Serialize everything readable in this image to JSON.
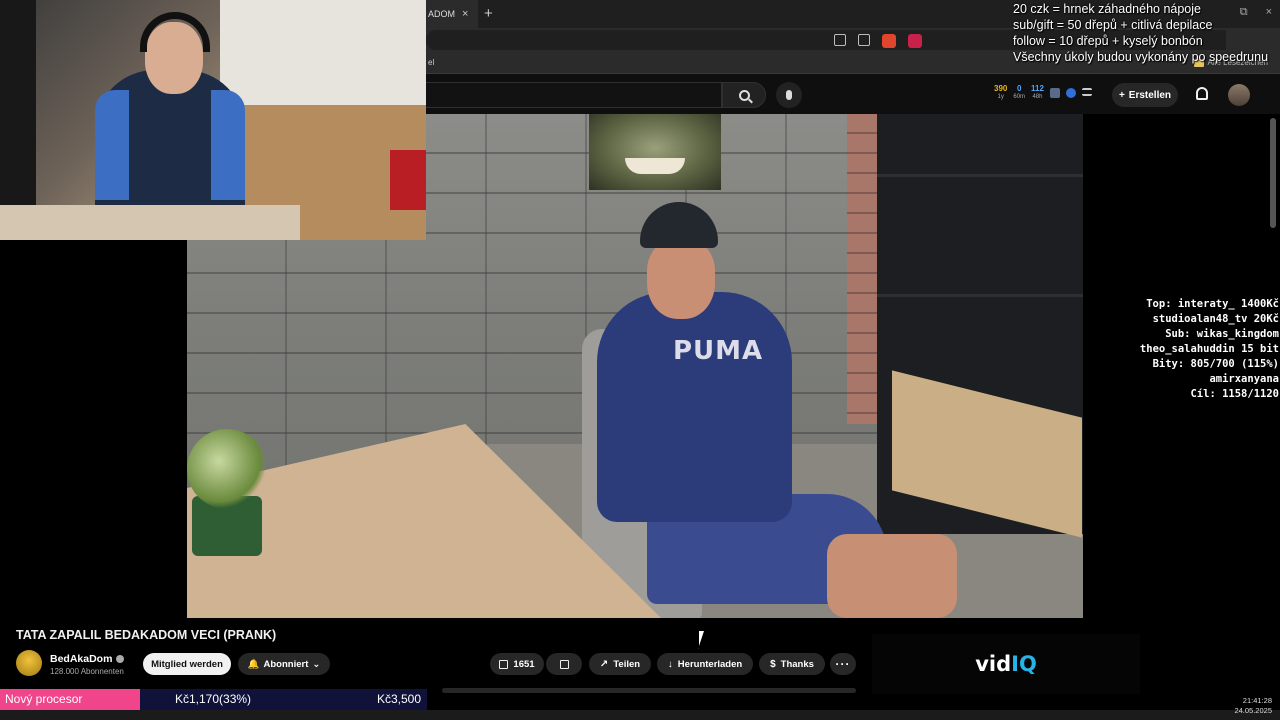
{
  "browser": {
    "tab_label": "ADOM",
    "tab_close": "×",
    "new_tab": "+",
    "bookmarks_short": "el",
    "all_bookmarks": "Alle Lesezeichen",
    "window_controls": [
      "⧉",
      "×"
    ]
  },
  "header": {
    "create_label": "Erstellen",
    "stats": [
      {
        "value": "390",
        "label": "1y",
        "color": "#e8b21e"
      },
      {
        "value": "0",
        "label": "60m",
        "color": "#4fa3ff"
      },
      {
        "value": "112",
        "label": "48h",
        "color": "#4fa3ff"
      }
    ]
  },
  "overlay_top": [
    "20 czk = hrnek záhadného nápoje",
    "sub/gift = 50 dřepů + citlivá depilace",
    "follow = 10 dřepů + kyselý bonbón",
    "Všechny úkoly budou vykonány po speedrunu"
  ],
  "overlay_right": [
    "Top: interaty_ 1400Kč",
    "studioalan48_tv 20Kč",
    "Sub: wikas_kingdom",
    "theo_salahuddin 15 bit",
    "Bity: 805/700 (115%)",
    "amirxanyana",
    "Cíl: 1158/1120"
  ],
  "video": {
    "title": "TATA ZAPALIL BEDAKADOM VECI (PRANK)",
    "shirt_text": "PUMA"
  },
  "channel": {
    "name": "BedAkaDom",
    "subscribers": "128.000 Abonnenten",
    "join_label": "Mitglied werden",
    "subscribed_label": "Abonniert"
  },
  "actions": {
    "likes": "1651",
    "share": "Teilen",
    "download": "Herunterladen",
    "thanks": "Thanks",
    "more": "···"
  },
  "sponsor": {
    "brand_a": "vid",
    "brand_b": "IQ"
  },
  "donation": {
    "label": "Nový procesor",
    "current": "Kč1,170(33%)",
    "goal": "Kč3,500",
    "fraction": 0.33
  },
  "clock": {
    "time": "21:41:28",
    "date": "24.05.2025"
  },
  "colors": {
    "accent_pink": "#f0458a",
    "bar_bg": "#10123a",
    "bar_fill": "#4a2ac7",
    "vidiq_blue": "#26b4e8"
  }
}
